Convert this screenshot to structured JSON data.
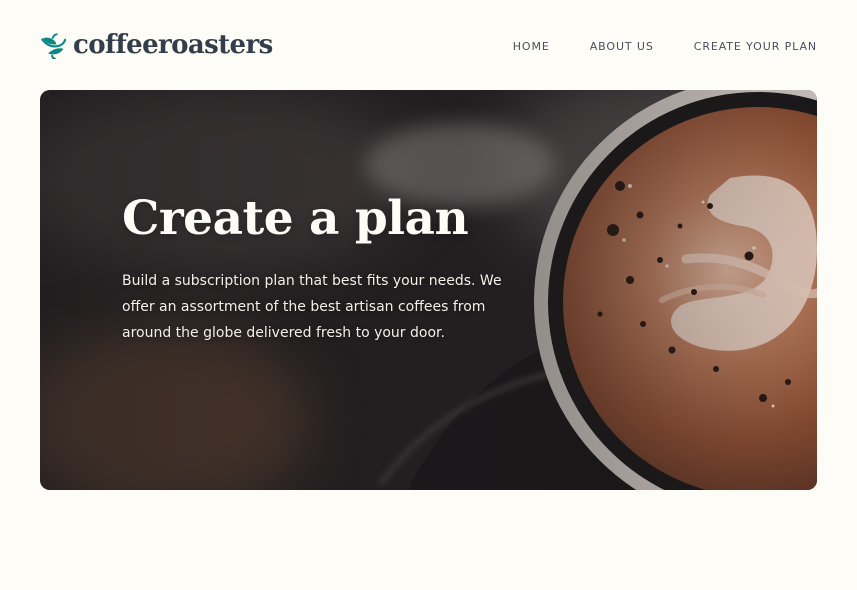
{
  "header": {
    "logo_text": "coffeeroasters",
    "logo_icon": "coffee-bean-icon",
    "nav": {
      "home": "HOME",
      "about": "ABOUT US",
      "create": "CREATE YOUR PLAN"
    }
  },
  "hero": {
    "title": "Create a plan",
    "description": "Build a subscription plan that best fits your needs. We offer an assortment of the best  artisan coffees from around the globe delivered fresh to your door."
  },
  "colors": {
    "page_background": "#fefcf7",
    "brand_text": "#333d4b",
    "brand_accent": "#0e8784",
    "nav_text": "#4a4f5a",
    "hero_text": "#fefcf7"
  }
}
